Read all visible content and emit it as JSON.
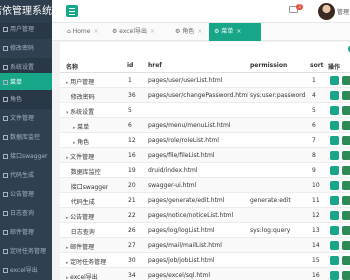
{
  "app": {
    "title": "若依管理系统",
    "user_name": "管理员",
    "mail_count": "3"
  },
  "sidebar": {
    "items": [
      {
        "label": "用户管理",
        "state": "open"
      },
      {
        "label": "修改密码",
        "state": ""
      },
      {
        "label": "系统设置",
        "state": "open"
      },
      {
        "label": "菜单",
        "state": "active"
      },
      {
        "label": "角色",
        "state": "sub"
      },
      {
        "label": "文件管理",
        "state": ""
      },
      {
        "label": "数据库监控",
        "state": ""
      },
      {
        "label": "接口swagger",
        "state": ""
      },
      {
        "label": "代码生成",
        "state": ""
      },
      {
        "label": "公告管理",
        "state": ""
      },
      {
        "label": "日志查询",
        "state": ""
      },
      {
        "label": "邮件管理",
        "state": ""
      },
      {
        "label": "定时任务管理",
        "state": ""
      },
      {
        "label": "excel导出",
        "state": ""
      }
    ]
  },
  "tabs": [
    {
      "label": "Home",
      "icon": "home-icon"
    },
    {
      "label": "excel导出",
      "icon": "gear-icon"
    },
    {
      "label": "角色",
      "icon": "folder-icon"
    },
    {
      "label": "菜单",
      "icon": "gear-icon",
      "active": true
    }
  ],
  "table": {
    "headers": {
      "name": "名称",
      "id": "id",
      "href": "href",
      "permission": "permission",
      "sort": "sort",
      "actions": "操作"
    },
    "rows": [
      {
        "name": "用户管理",
        "id": "1",
        "href": "pages/user/userList.html",
        "permission": "",
        "sort": "1",
        "level": 0,
        "toggle": "▸"
      },
      {
        "name": "修改密码",
        "id": "36",
        "href": "pages/user/changePassword.html",
        "permission": "sys:user:password",
        "sort": "4",
        "level": 0,
        "toggle": ""
      },
      {
        "name": "系统设置",
        "id": "5",
        "href": "",
        "permission": "",
        "sort": "5",
        "level": 0,
        "toggle": "▾"
      },
      {
        "name": "菜单",
        "id": "6",
        "href": "pages/menu/menuList.html",
        "permission": "",
        "sort": "6",
        "level": 1,
        "toggle": "▸"
      },
      {
        "name": "角色",
        "id": "12",
        "href": "pages/role/roleList.html",
        "permission": "",
        "sort": "7",
        "level": 1,
        "toggle": "▸"
      },
      {
        "name": "文件管理",
        "id": "16",
        "href": "pages/file/fileList.html",
        "permission": "",
        "sort": "8",
        "level": 0,
        "toggle": "▸"
      },
      {
        "name": "数据库监控",
        "id": "19",
        "href": "druid/index.html",
        "permission": "",
        "sort": "9",
        "level": 0,
        "toggle": ""
      },
      {
        "name": "接口swagger",
        "id": "20",
        "href": "swagger-ui.html",
        "permission": "",
        "sort": "10",
        "level": 0,
        "toggle": ""
      },
      {
        "name": "代码生成",
        "id": "21",
        "href": "pages/generate/edit.html",
        "permission": "generate:edit",
        "sort": "11",
        "level": 0,
        "toggle": ""
      },
      {
        "name": "公告管理",
        "id": "22",
        "href": "pages/notice/noticeList.html",
        "permission": "",
        "sort": "12",
        "level": 0,
        "toggle": "▸"
      },
      {
        "name": "日志查询",
        "id": "26",
        "href": "pages/log/logList.html",
        "permission": "sys:log:query",
        "sort": "13",
        "level": 0,
        "toggle": ""
      },
      {
        "name": "邮件管理",
        "id": "27",
        "href": "pages/mail/mailList.html",
        "permission": "",
        "sort": "14",
        "level": 0,
        "toggle": "▸"
      },
      {
        "name": "定时任务管理",
        "id": "30",
        "href": "pages/job/jobList.html",
        "permission": "",
        "sort": "15",
        "level": 0,
        "toggle": "▸"
      },
      {
        "name": "excel导出",
        "id": "34",
        "href": "pages/excel/sql.html",
        "permission": "",
        "sort": "16",
        "level": 0,
        "toggle": "▸"
      }
    ]
  },
  "colors": {
    "sidebar": "#2f4050",
    "accent": "#18a689"
  }
}
